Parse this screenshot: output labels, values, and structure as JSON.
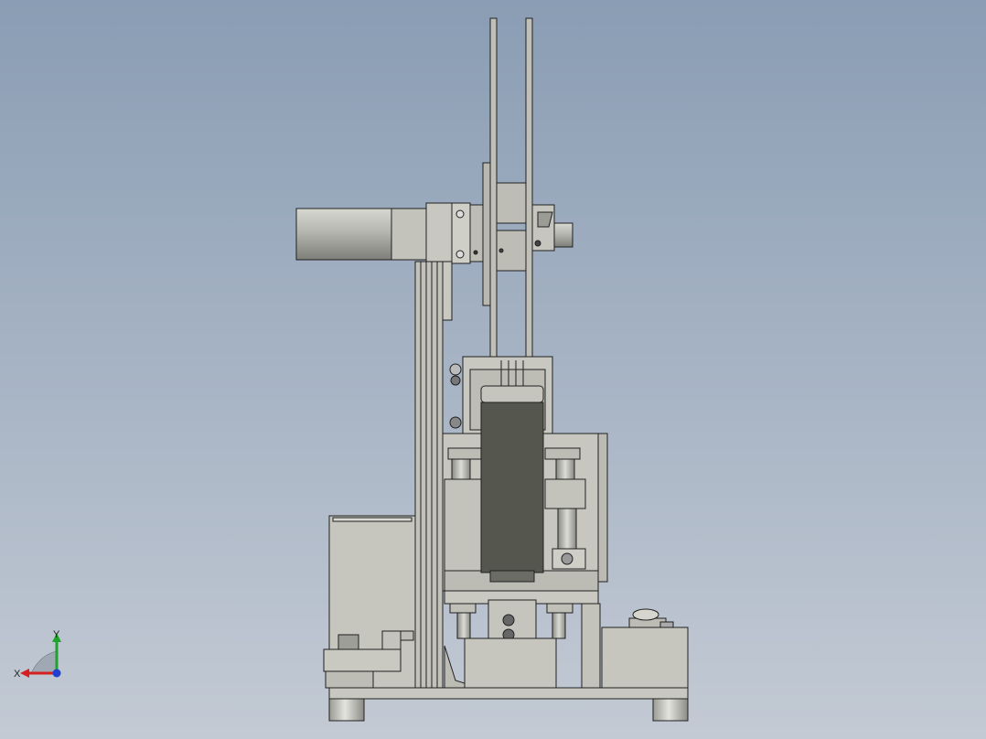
{
  "viewport": {
    "background_top": "#8a9db4",
    "background_bottom": "#c3cad4",
    "model_name": "machine-assembly-front-view"
  },
  "triad": {
    "x_label": "X",
    "y_label": "Y",
    "x_color": "#d42020",
    "y_color": "#1fa32c",
    "z_color": "#1f3fd0"
  },
  "palette": {
    "steel_light": "#c9c9c2",
    "steel_mid": "#b5b5ae",
    "steel_dark": "#8e8e88",
    "edge": "#202020",
    "belt": "#55574f",
    "motor": "#a9a9a3"
  }
}
